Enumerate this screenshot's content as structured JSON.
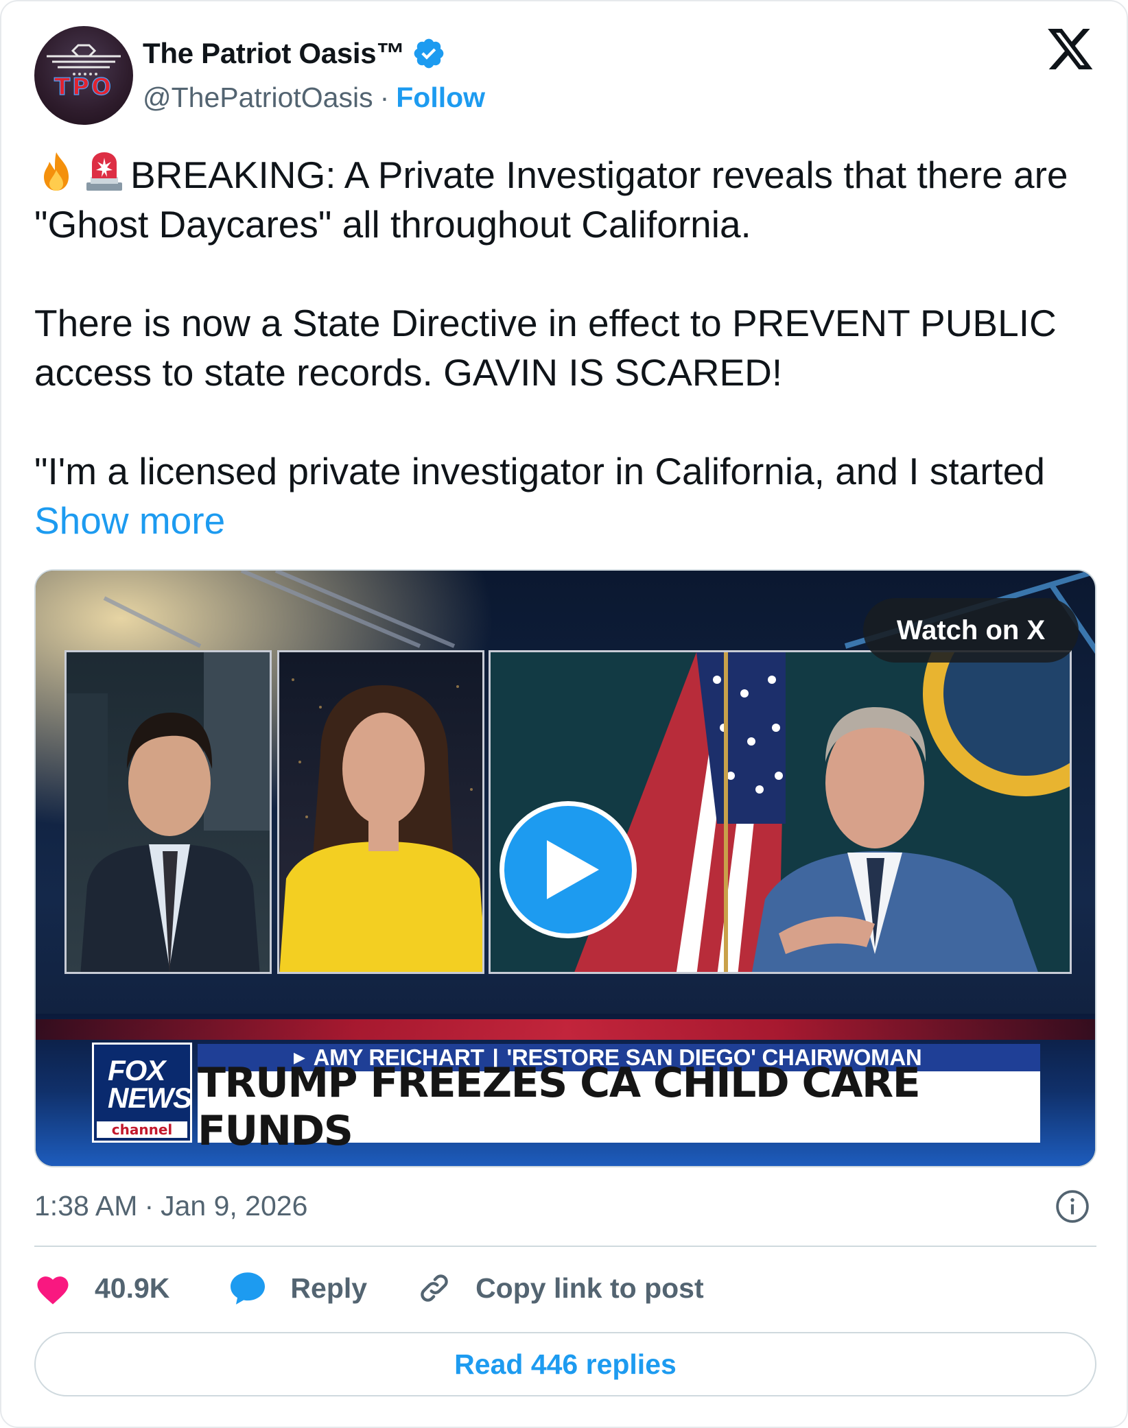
{
  "author": {
    "name": "The Patriot Oasis™",
    "handle": "@ThePatriotOasis",
    "separator": "·",
    "follow_label": "Follow",
    "avatar_text": "TPO",
    "verified": true
  },
  "platform_icon": "x-logo-icon",
  "tweet": {
    "paragraph1": "BREAKING: A Private Investigator reveals that there are \"Ghost Daycares\" all throughout California.",
    "paragraph2": "There is now a State Directive in effect to PREVENT PUBLIC access to state records. GAVIN IS SCARED!",
    "paragraph3": "\"I'm a licensed private investigator in California, and I started",
    "show_more_label": "Show more",
    "emojis": [
      "fire-emoji",
      "police-light-emoji"
    ]
  },
  "media": {
    "watch_label": "Watch on X",
    "network_logo_lines": [
      "FOX",
      "NEWS"
    ],
    "network_logo_sub": "channel",
    "chyron_name": "AMY REICHART",
    "chyron_divider": "|",
    "chyron_title": "'RESTORE SAN DIEGO' CHAIRWOMAN",
    "chyron_headline": "TRUMP FREEZES CA CHILD CARE FUNDS"
  },
  "meta": {
    "time": "1:38 AM",
    "separator": "·",
    "date": "Jan 9, 2026"
  },
  "actions": {
    "likes": "40.9K",
    "reply_label": "Reply",
    "copy_label": "Copy link to post"
  },
  "read_replies_label": "Read 446 replies",
  "colors": {
    "accent": "#1d9bf0",
    "like": "#f91880",
    "text_primary": "#0f1419",
    "text_secondary": "#536471",
    "border": "#cfd9de"
  }
}
